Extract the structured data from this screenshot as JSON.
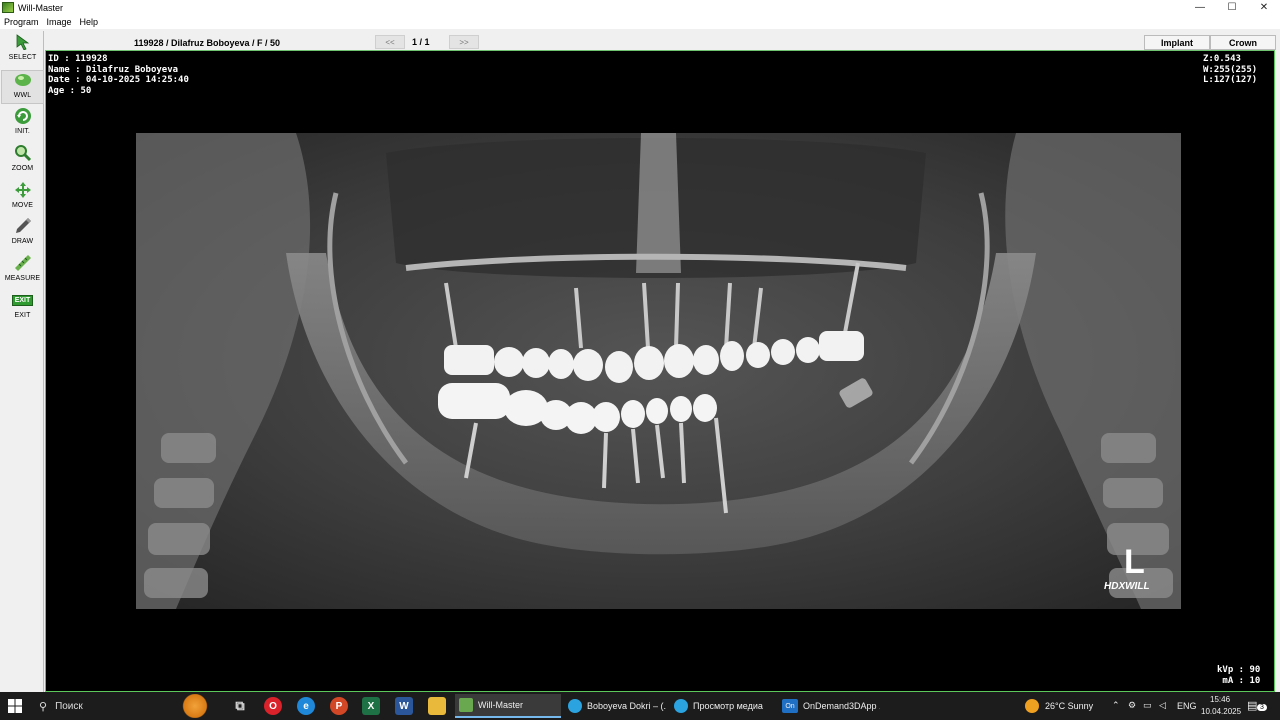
{
  "window": {
    "title": "Will-Master",
    "controls": [
      "—",
      "☐",
      "✕"
    ]
  },
  "menu": [
    "Program",
    "Image",
    "Help"
  ],
  "toolbar": [
    {
      "label": "SELECT",
      "icon": "cursor-arrow-icon"
    },
    {
      "label": "WWL",
      "icon": "contrast-sphere-icon",
      "active": true
    },
    {
      "label": "INIT.",
      "icon": "refresh-icon"
    },
    {
      "label": "ZOOM",
      "icon": "magnifier-icon"
    },
    {
      "label": "MOVE",
      "icon": "move-arrows-icon"
    },
    {
      "label": "DRAW",
      "icon": "pencil-icon"
    },
    {
      "label": "MEASURE",
      "icon": "ruler-icon"
    },
    {
      "label": "EXIT",
      "icon": "exit-icon",
      "badge": "EXIT"
    }
  ],
  "header": {
    "patient": "119928 / Dilafruz Boboyeva / F / 50",
    "prev": "<<",
    "page": "1 / 1",
    "next": ">>",
    "tabs": [
      "Implant",
      "Crown"
    ]
  },
  "overlay": {
    "info": "ID : 119928\nName : Dilafruz Boboyeva\nDate : 04-10-2025 14:25:40\nAge : 50",
    "zoom": "Z:0.543\nW:255(255)\nL:127(127)",
    "exposure": "kVp : 90\n mA : 10",
    "side": "L",
    "brand": "HDXWILL"
  },
  "taskbar": {
    "search": "Поиск",
    "apps": [
      {
        "label": "Will-Master",
        "active": true,
        "color": "#6aa84f"
      },
      {
        "label": "Boboyeva Dokri – (...",
        "color": "#2aa3e0",
        "badge": "1"
      },
      {
        "label": "Просмотр медиа",
        "color": "#2aa3e0"
      },
      {
        "label": "OnDemand3DApp ...",
        "color": "#1f6fc4",
        "badge": "On"
      }
    ],
    "weather": "26°C  Sunny",
    "lang": "ENG",
    "time": "15:46",
    "date": "10.04.2025",
    "notif": "3"
  },
  "colors": {
    "accent_border": "#5cc85c",
    "viewer_bg": "#000000",
    "taskbar_bg": "#1c1c1c"
  }
}
